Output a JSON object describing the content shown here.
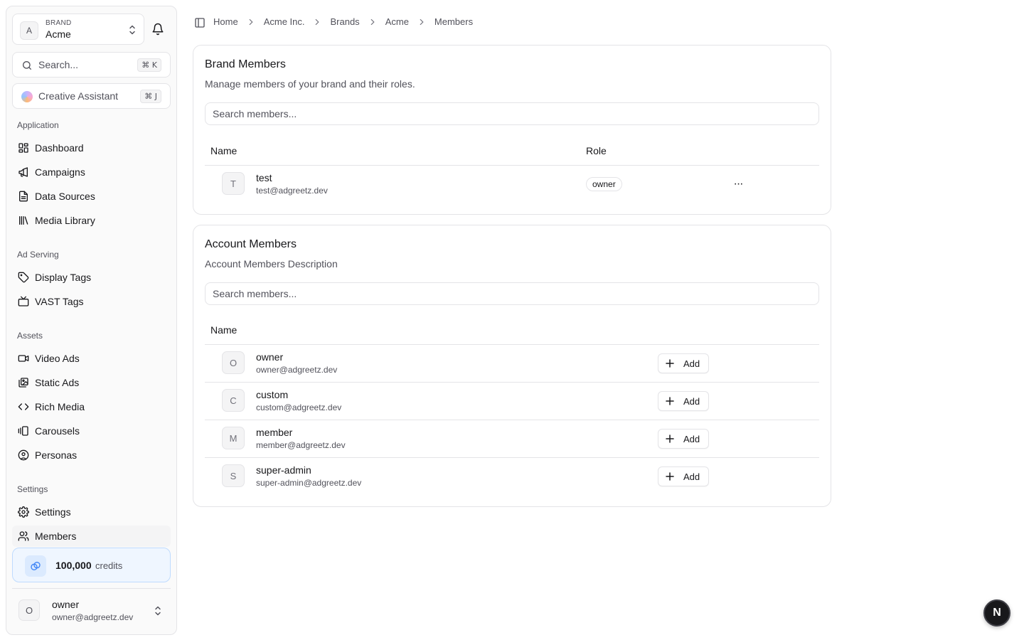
{
  "sidebar": {
    "brand": {
      "kicker": "BRAND",
      "name": "Acme",
      "avatar": "A"
    },
    "search": {
      "label": "Search...",
      "shortcut": "⌘ K"
    },
    "assistant": {
      "label": "Creative Assistant",
      "shortcut": "⌘ J"
    },
    "groups": [
      {
        "label": "Application",
        "items": [
          {
            "label": "Dashboard",
            "icon": "dashboard-icon"
          },
          {
            "label": "Campaigns",
            "icon": "megaphone-icon"
          },
          {
            "label": "Data Sources",
            "icon": "file-icon"
          },
          {
            "label": "Media Library",
            "icon": "library-icon"
          }
        ]
      },
      {
        "label": "Ad Serving",
        "items": [
          {
            "label": "Display Tags",
            "icon": "tag-icon"
          },
          {
            "label": "VAST Tags",
            "icon": "tv-icon"
          }
        ]
      },
      {
        "label": "Assets",
        "items": [
          {
            "label": "Video Ads",
            "icon": "video-icon"
          },
          {
            "label": "Static Ads",
            "icon": "images-icon"
          },
          {
            "label": "Rich Media",
            "icon": "code-icon"
          },
          {
            "label": "Carousels",
            "icon": "carousel-icon"
          },
          {
            "label": "Personas",
            "icon": "user-circle-icon"
          }
        ]
      },
      {
        "label": "Settings",
        "items": [
          {
            "label": "Settings",
            "icon": "gear-icon"
          },
          {
            "label": "Members",
            "icon": "users-icon",
            "active": true
          }
        ]
      }
    ],
    "credits": {
      "amount": "100,000",
      "label": "credits"
    },
    "user": {
      "avatar": "O",
      "name": "owner",
      "email": "owner@adgreetz.dev"
    }
  },
  "breadcrumb": [
    "Home",
    "Acme Inc.",
    "Brands",
    "Acme",
    "Members"
  ],
  "brand_members": {
    "title": "Brand Members",
    "description": "Manage members of your brand and their roles.",
    "search_placeholder": "Search members...",
    "columns": {
      "name": "Name",
      "role": "Role"
    },
    "rows": [
      {
        "avatar": "T",
        "name": "test",
        "email": "test@adgreetz.dev",
        "role": "owner",
        "actions": "···"
      }
    ]
  },
  "account_members": {
    "title": "Account Members",
    "description": "Account Members Description",
    "search_placeholder": "Search members...",
    "columns": {
      "name": "Name"
    },
    "add_label": "Add",
    "rows": [
      {
        "avatar": "O",
        "name": "owner",
        "email": "owner@adgreetz.dev"
      },
      {
        "avatar": "C",
        "name": "custom",
        "email": "custom@adgreetz.dev"
      },
      {
        "avatar": "M",
        "name": "member",
        "email": "member@adgreetz.dev"
      },
      {
        "avatar": "S",
        "name": "super-admin",
        "email": "super-admin@adgreetz.dev"
      }
    ]
  },
  "next_badge": "N",
  "colors": {
    "accent": "#3b82f6",
    "credits_bg": "#eff6ff",
    "border": "#e4e4e7",
    "muted_text": "#52525b"
  }
}
